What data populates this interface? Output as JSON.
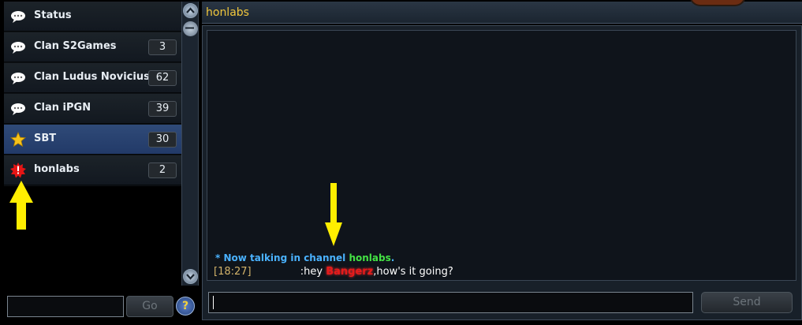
{
  "channels": [
    {
      "label": "Status",
      "count": "",
      "icon": "speech-bubble-icon"
    },
    {
      "label": "Clan S2Games",
      "count": "3",
      "icon": "speech-bubble-icon"
    },
    {
      "label": "Clan Ludus Novicius",
      "count": "62",
      "icon": "speech-bubble-icon"
    },
    {
      "label": "Clan iPGN",
      "count": "39",
      "icon": "speech-bubble-icon"
    },
    {
      "label": "SBT",
      "count": "30",
      "icon": "star-icon"
    },
    {
      "label": "honlabs",
      "count": "2",
      "icon": "alert-burst-icon"
    }
  ],
  "sidebar": {
    "join_input_value": "",
    "go_label": "Go",
    "help_label": "?"
  },
  "chat": {
    "title": "honlabs",
    "system_prefix": "* Now talking in channel ",
    "system_channel": "honlabs",
    "system_suffix": ".",
    "message": {
      "time": "[18:27]",
      "sender": "",
      "pre": ":hey ",
      "mention": "Bangerz",
      "post": ",how's it going?"
    },
    "input_value": "",
    "send_label": "Send"
  },
  "colors": {
    "accent_yellow": "#ffee00",
    "selected_blue": "#2f4a78",
    "system_blue": "#4ab2ff",
    "channel_green": "#44e244",
    "mention_red": "#e61b1b",
    "title_gold": "#f1c73c"
  }
}
